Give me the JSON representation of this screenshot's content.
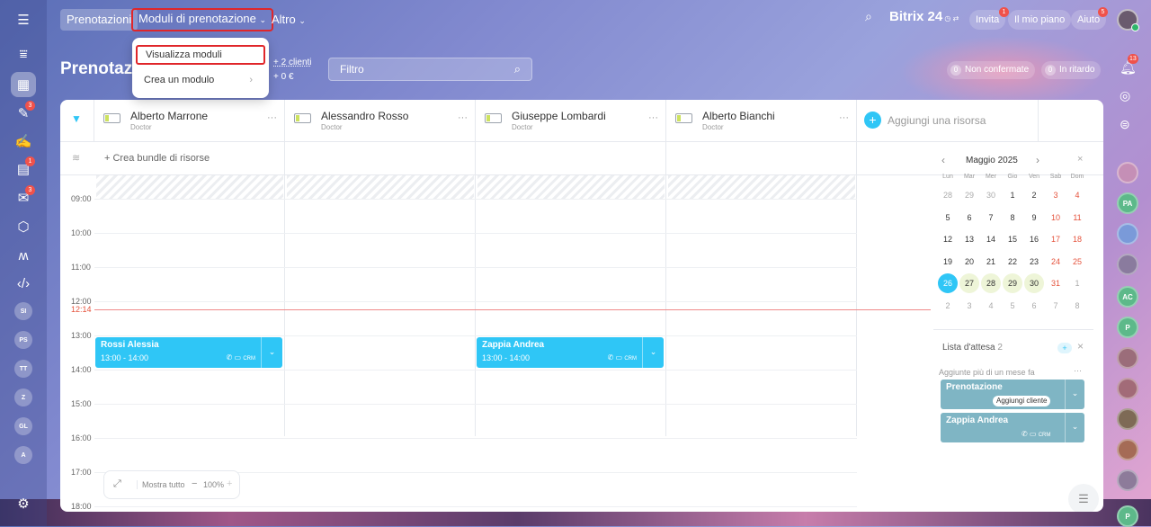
{
  "topbar": {
    "tab_prenotazioni": "Prenotazioni",
    "tab_moduli": "Moduli di prenotazione",
    "tab_altro": "Altro",
    "brand": "Bitrix",
    "brand_num": "24",
    "invita": "Invita",
    "invita_badge": "1",
    "mio_piano": "Il mio piano",
    "aiuto": "Aiuto",
    "aiuto_badge": "5"
  },
  "dropdown": {
    "item1": "Visualizza moduli",
    "item2": "Crea un modulo"
  },
  "header": {
    "title": "Prenotazi",
    "clients": "+ 2 clienti",
    "money": "+ 0 €",
    "filter_placeholder": "Filtro",
    "non_confermate_count": "0",
    "non_confermate": "Non confermate",
    "in_ritardo_count": "0",
    "in_ritardo": "In ritardo"
  },
  "resources": [
    {
      "name": "Alberto Marrone",
      "role": "Doctor"
    },
    {
      "name": "Alessandro Rosso",
      "role": "Doctor"
    },
    {
      "name": "Giuseppe Lombardi",
      "role": "Doctor"
    },
    {
      "name": "Alberto Bianchi",
      "role": "Doctor"
    }
  ],
  "add_resource": "Aggiungi una risorsa",
  "bundle": "+ Crea bundle di risorse",
  "times": [
    "09:00",
    "10:00",
    "11:00",
    "12:00",
    "13:00",
    "14:00",
    "15:00",
    "16:00",
    "17:00",
    "18:00"
  ],
  "now": "12:14",
  "events": [
    {
      "name": "Rossi Alessia",
      "time": "13:00 - 14:00",
      "crm": "CRM"
    },
    {
      "name": "Zappia Andrea",
      "time": "13:00 - 14:00",
      "crm": "CRM"
    }
  ],
  "zoom": {
    "show_all": "Mostra tutto",
    "minus": "−",
    "level": "100%",
    "plus": "+"
  },
  "calendar": {
    "title": "Maggio 2025",
    "weekdays": [
      "Lun",
      "Mar",
      "Mer",
      "Gio",
      "Ven",
      "Sab",
      "Dom"
    ],
    "weeks": [
      [
        "28",
        "29",
        "30",
        "1",
        "2",
        "3",
        "4"
      ],
      [
        "5",
        "6",
        "7",
        "8",
        "9",
        "10",
        "11"
      ],
      [
        "12",
        "13",
        "14",
        "15",
        "16",
        "17",
        "18"
      ],
      [
        "19",
        "20",
        "21",
        "22",
        "23",
        "24",
        "25"
      ],
      [
        "26",
        "27",
        "28",
        "29",
        "30",
        "31",
        "1"
      ],
      [
        "2",
        "3",
        "4",
        "5",
        "6",
        "7",
        "8"
      ]
    ],
    "today": "26"
  },
  "waitlist": {
    "title": "Lista d'attesa",
    "count": "2",
    "plus": "+",
    "close": "×",
    "section": "Aggiunte più di un mese fa",
    "dots": "···",
    "items": [
      {
        "name": "Prenotazione",
        "action": "Aggiungi cliente"
      },
      {
        "name": "Zappia Andrea",
        "crm": "CRM"
      }
    ]
  },
  "left_badges": [
    "3",
    "1",
    "3"
  ],
  "left_avatars": [
    "SI",
    "PS",
    "TT",
    "Z",
    "GL",
    "A"
  ],
  "right_badge": "13",
  "right_avatars": [
    "PA",
    "AC",
    "P",
    "P"
  ],
  "colors": {
    "accent": "#2fc6f6",
    "highlight": "#e0262a",
    "now_line": "#f08a8a",
    "weekend": "#e5533d"
  }
}
